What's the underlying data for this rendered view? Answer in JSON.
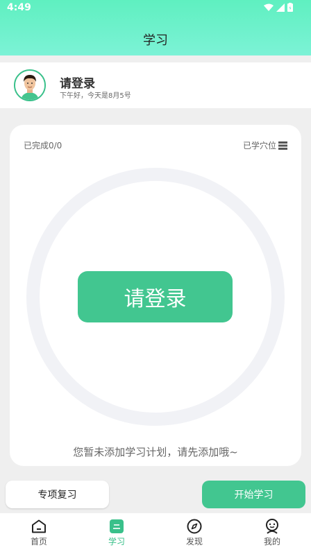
{
  "status_bar": {
    "time": "4:49"
  },
  "header": {
    "title": "学习"
  },
  "user": {
    "name": "请登录",
    "greeting": "下午好，今天是8月5号"
  },
  "card": {
    "completed": "已完成0/0",
    "learned_points": "已学穴位",
    "login_button": "请登录",
    "empty_hint": "您暂未添加学习计划，请先添加哦~"
  },
  "actions": {
    "review": "专项复习",
    "start": "开始学习"
  },
  "tabs": [
    {
      "label": "首页",
      "icon": "home-icon"
    },
    {
      "label": "学习",
      "icon": "study-icon"
    },
    {
      "label": "发现",
      "icon": "compass-icon"
    },
    {
      "label": "我的",
      "icon": "profile-icon"
    }
  ],
  "colors": {
    "accent": "#42c690",
    "header": "#6ff1cc",
    "ring": "#f1f2f6"
  }
}
